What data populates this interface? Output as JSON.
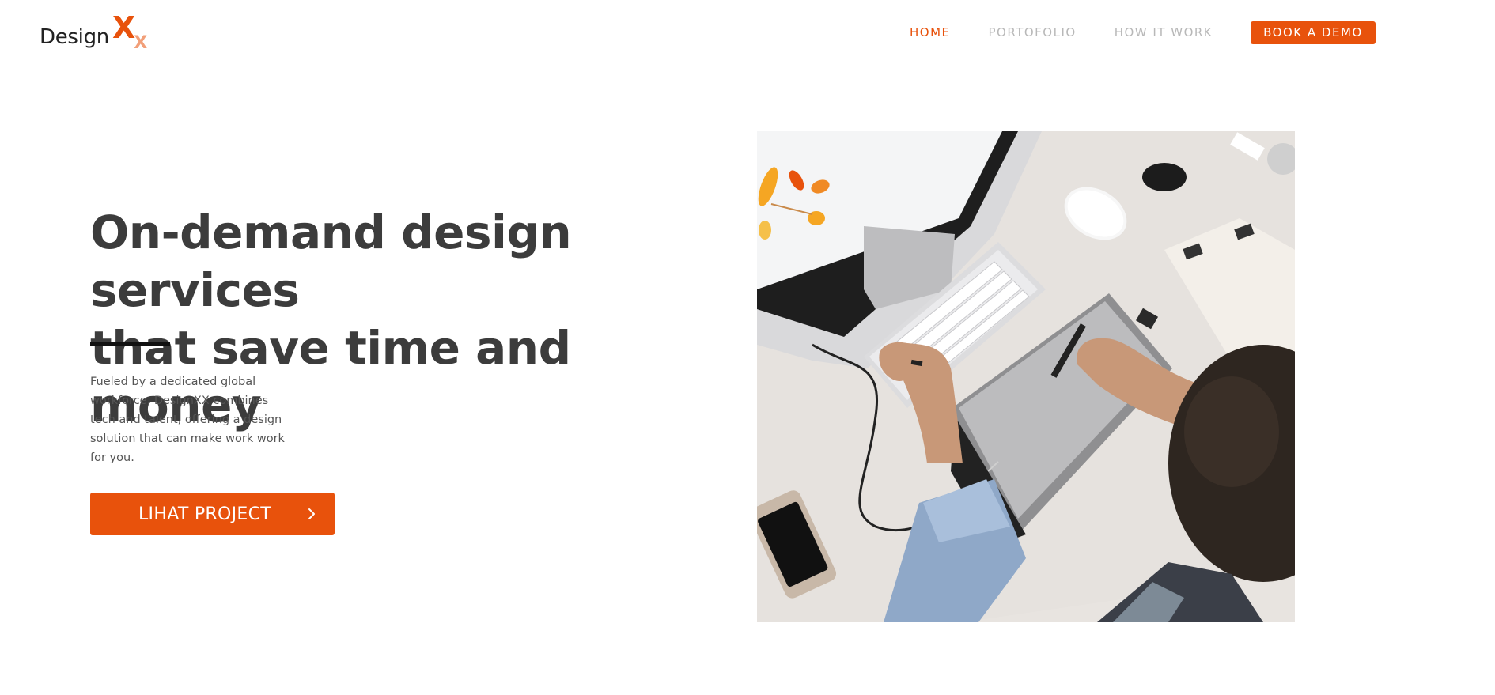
{
  "brand": {
    "word": "Design",
    "mark_large": "X",
    "mark_small": "X"
  },
  "nav": {
    "items": [
      {
        "label": "HOME",
        "active": true
      },
      {
        "label": "PORTOFOLIO",
        "active": false
      },
      {
        "label": "HOW IT WORK",
        "active": false
      }
    ],
    "cta_label": "BOOK A DEMO"
  },
  "hero": {
    "title_line1": "On-demand design services",
    "title_line2": "that save time and money",
    "description": "Fueled by a dedicated global workforce, DesignXX combines tech and talent, offering a design solution that can make work work for you.",
    "cta_label": "LIHAT PROJECT",
    "cta_icon": "chevron-right-icon",
    "image_subject": "designer-desk-photo"
  },
  "colors": {
    "accent": "#e8520c",
    "heading": "#3c3c3c",
    "body_text": "#555555",
    "nav_inactive": "#b8b8b8",
    "rule": "#111111"
  }
}
